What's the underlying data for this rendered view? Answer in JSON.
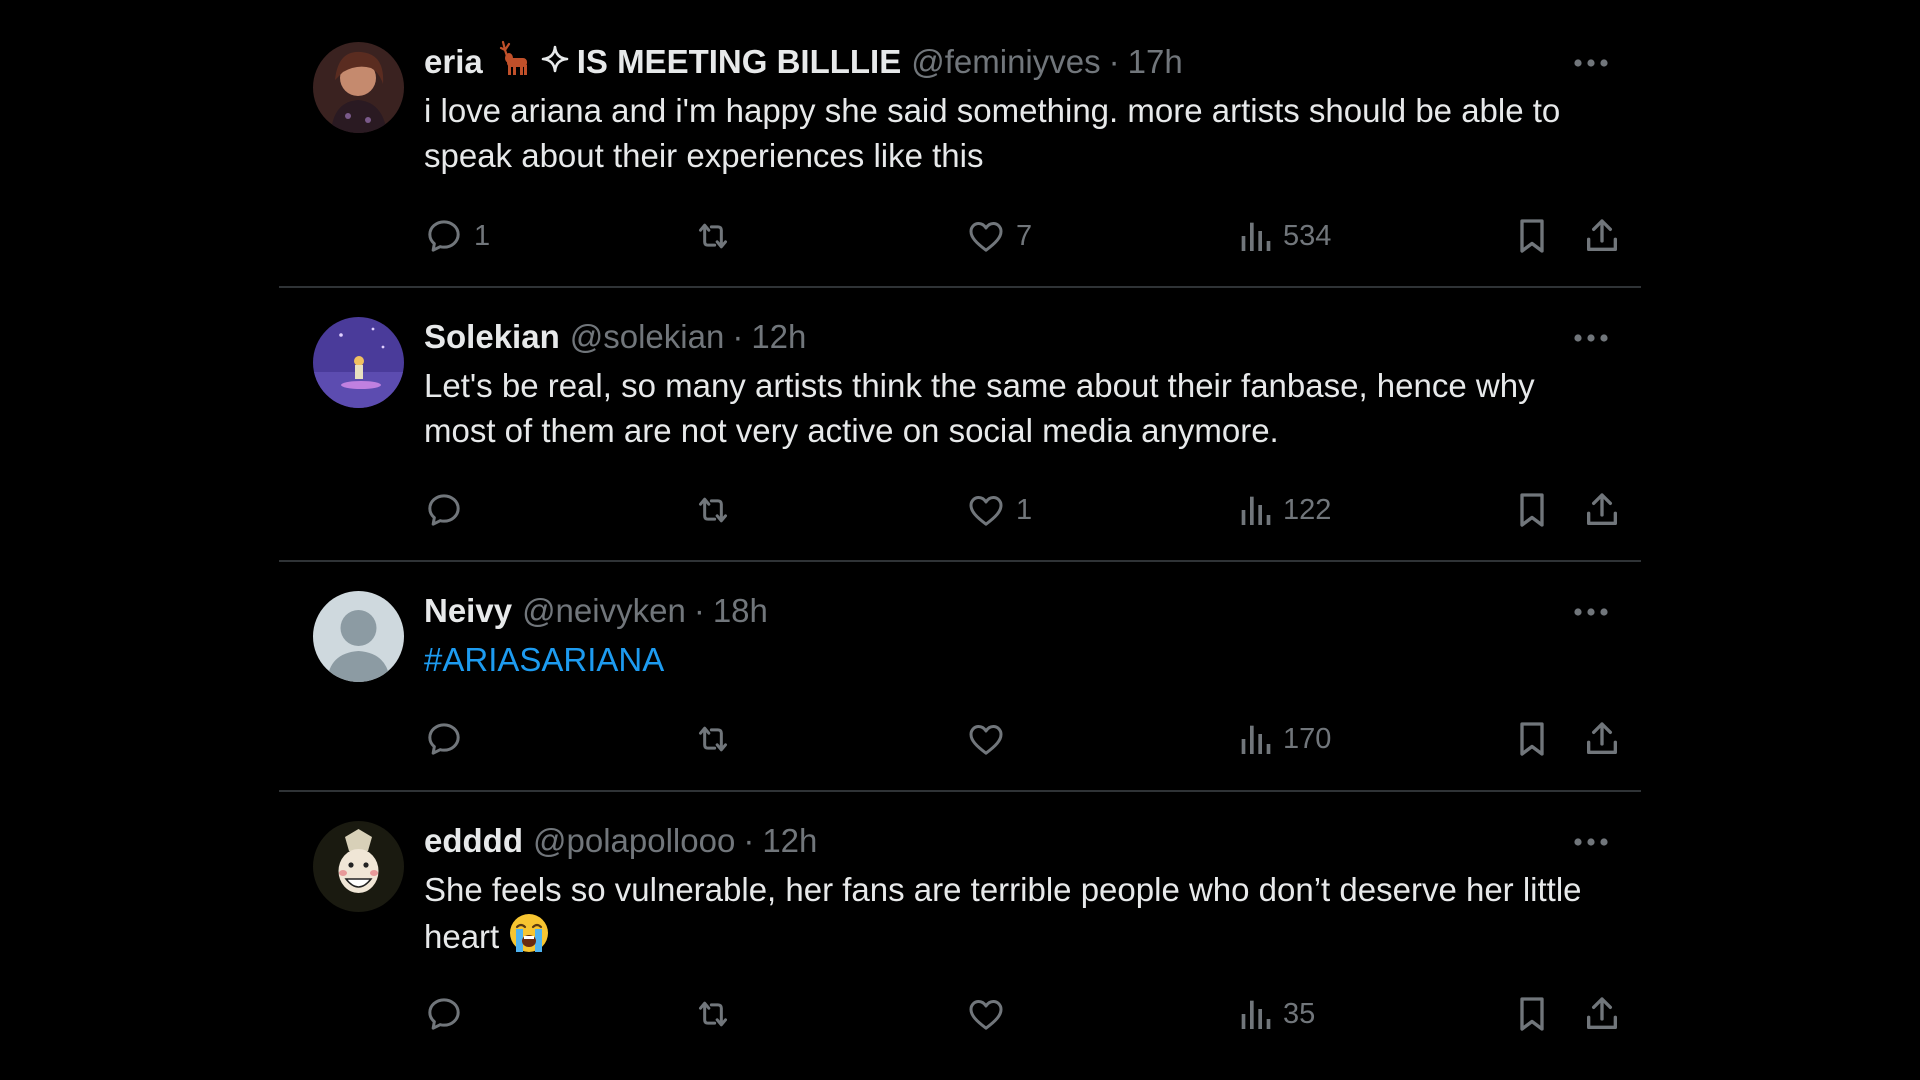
{
  "tweets": [
    {
      "display_name": "eria",
      "name_suffix": "IS MEETING BILLLIE",
      "name_emoji": "deer",
      "name_sparkle_icon": "sparkle-icon",
      "handle": "@feminiyves",
      "separator": "·",
      "time": "17h",
      "text": "i love ariana and i'm happy she said something. more artists should be able to speak about their experiences like this",
      "replies": "1",
      "retweets": "",
      "likes": "7",
      "views": "534"
    },
    {
      "display_name": "Solekian",
      "handle": "@solekian",
      "separator": "·",
      "time": "12h",
      "text": "Let's be real, so many artists think the same about their fanbase, hence why most of them are not very active on social media anymore.",
      "replies": "",
      "retweets": "",
      "likes": "1",
      "views": "122"
    },
    {
      "display_name": "Neivy",
      "handle": "@neivyken",
      "separator": "·",
      "time": "18h",
      "text": "#ARIASARIANA",
      "replies": "",
      "retweets": "",
      "likes": "",
      "views": "170"
    },
    {
      "display_name": "edddd",
      "handle": "@polapollooo",
      "separator": "·",
      "time": "12h",
      "text": "She feels so vulnerable, her fans are terrible people who don’t deserve her little heart",
      "text_emoji": "loudly-crying-face",
      "replies": "",
      "retweets": "",
      "likes": "",
      "views": "35"
    }
  ],
  "colors": {
    "background": "#000000",
    "primary_text": "#e7e9ea",
    "secondary_text": "#71767b",
    "divider": "#2f3336",
    "link": "#1d9bf0"
  },
  "icons": {
    "reply": "reply-icon",
    "retweet": "retweet-icon",
    "like": "heart-icon",
    "views": "views-chart-icon",
    "bookmark": "bookmark-icon",
    "share": "share-icon",
    "more": "more-icon"
  }
}
